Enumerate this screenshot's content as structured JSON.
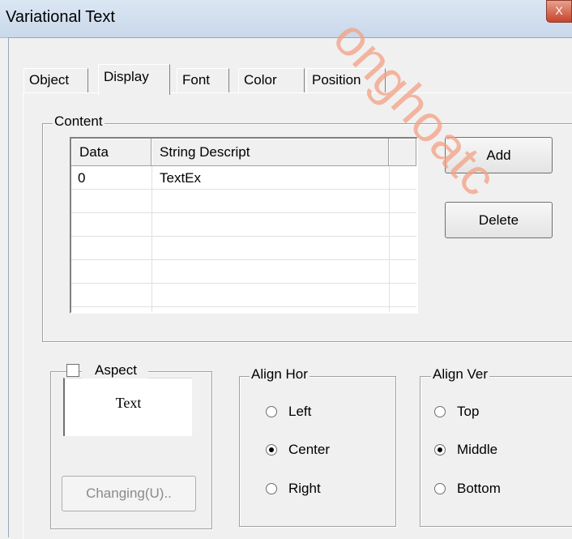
{
  "window": {
    "title": "Variational Text",
    "close_glyph": "X"
  },
  "tabs": [
    {
      "label": "Object",
      "active": false
    },
    {
      "label": "Display",
      "active": true
    },
    {
      "label": "Font",
      "active": false
    },
    {
      "label": "Color",
      "active": false
    },
    {
      "label": "Position",
      "active": false
    }
  ],
  "content": {
    "group_label": "Content",
    "columns": [
      "Data",
      "String Descript"
    ],
    "rows": [
      {
        "data": "0",
        "string": "TextEx"
      }
    ],
    "add_label": "Add",
    "delete_label": "Delete"
  },
  "aspect": {
    "label": "Aspect",
    "checked": false,
    "preview_text": "Text",
    "changing_label": "Changing(U).."
  },
  "align_hor": {
    "label": "Align Hor",
    "options": [
      "Left",
      "Center",
      "Right"
    ],
    "selected": "Center"
  },
  "align_ver": {
    "label": "Align Ver",
    "options": [
      "Top",
      "Middle",
      "Bottom"
    ],
    "selected": "Middle"
  },
  "watermark": "onghoatc",
  "colors": {
    "watermark": "#f3a184",
    "close_button": "#c7432b"
  }
}
